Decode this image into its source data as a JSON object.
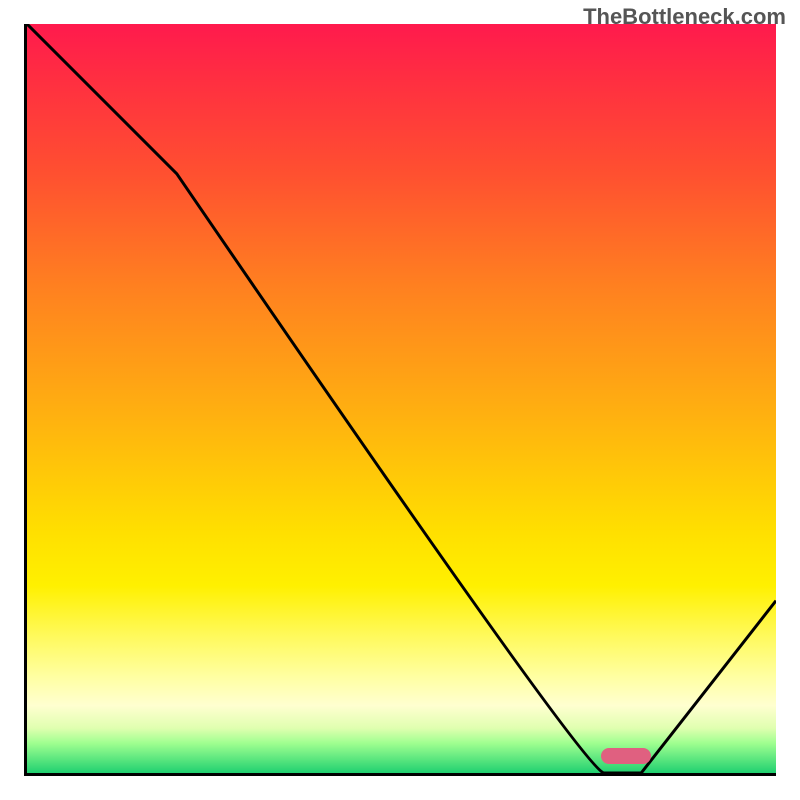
{
  "watermark": "TheBottleneck.com",
  "chart_data": {
    "type": "line",
    "title": "",
    "xlabel": "",
    "ylabel": "",
    "xlim": [
      0,
      100
    ],
    "ylim": [
      0,
      100
    ],
    "grid": false,
    "legend": false,
    "series": [
      {
        "name": "curve",
        "x": [
          0,
          20,
          77,
          82,
          100
        ],
        "values": [
          100,
          80,
          0,
          0,
          23
        ]
      }
    ],
    "marker": {
      "x_center": 80,
      "y": 2
    },
    "background_gradient": {
      "stops": [
        {
          "pos": 0,
          "color": "#ff1a4d"
        },
        {
          "pos": 35,
          "color": "#ff8020"
        },
        {
          "pos": 68,
          "color": "#ffe000"
        },
        {
          "pos": 90,
          "color": "#ffffc0"
        },
        {
          "pos": 100,
          "color": "#20d070"
        }
      ]
    }
  }
}
